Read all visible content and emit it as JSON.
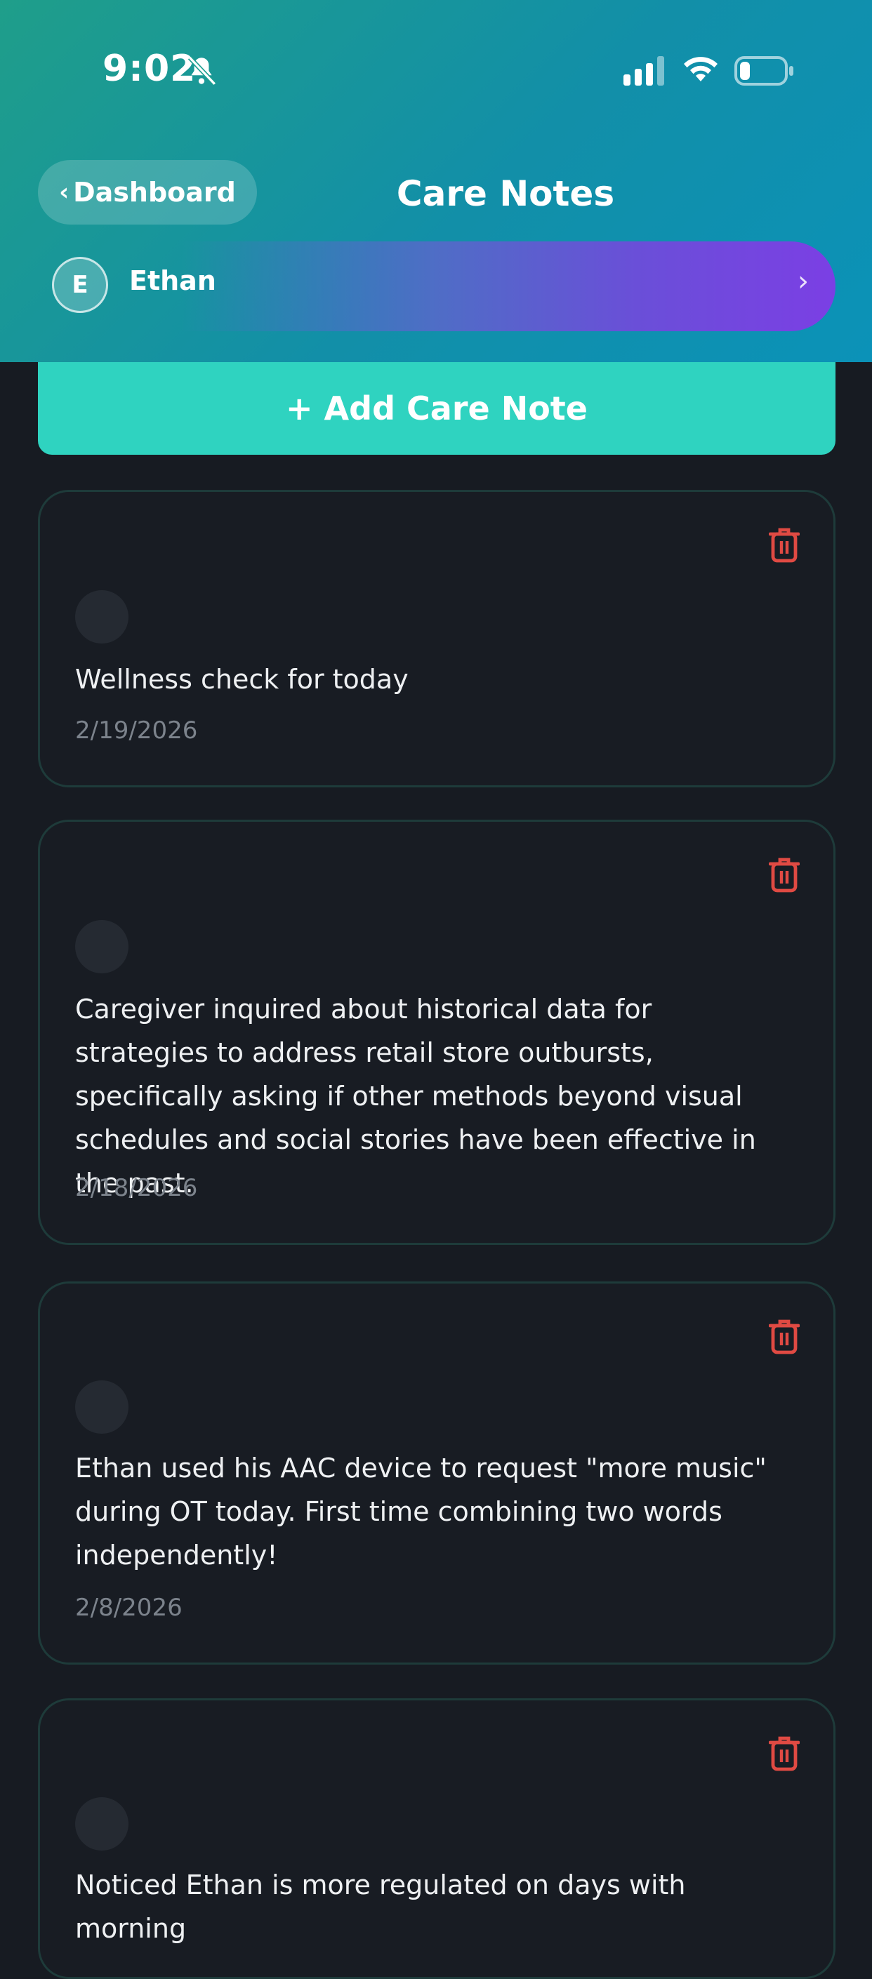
{
  "status_bar": {
    "time": "9:02",
    "icons": [
      "bell-slash-icon",
      "cellular-signal-icon",
      "wifi-icon",
      "battery-icon"
    ]
  },
  "header": {
    "back_label": "Dashboard",
    "title": "Care Notes"
  },
  "patient": {
    "initial": "E",
    "name": "Ethan"
  },
  "add_button": {
    "label": "+ Add Care Note"
  },
  "notes": [
    {
      "text": "Wellness check for today",
      "date": "2/19/2026"
    },
    {
      "text": "Caregiver inquired about historical data for strategies to address retail store outbursts, specifically asking if other methods beyond visual schedules and social stories have been effective in the past.",
      "date": "2/18/2026"
    },
    {
      "text": "Ethan used his AAC device to request \"more music\" during OT today. First time combining two words independently!",
      "date": "2/8/2026"
    },
    {
      "text": "Noticed Ethan is more regulated on days with morning",
      "date": ""
    }
  ],
  "colors": {
    "accent": "#2fd3c0",
    "background": "#171b22",
    "delete": "#e04a43",
    "patient_bar_end": "#7b3fe4"
  }
}
